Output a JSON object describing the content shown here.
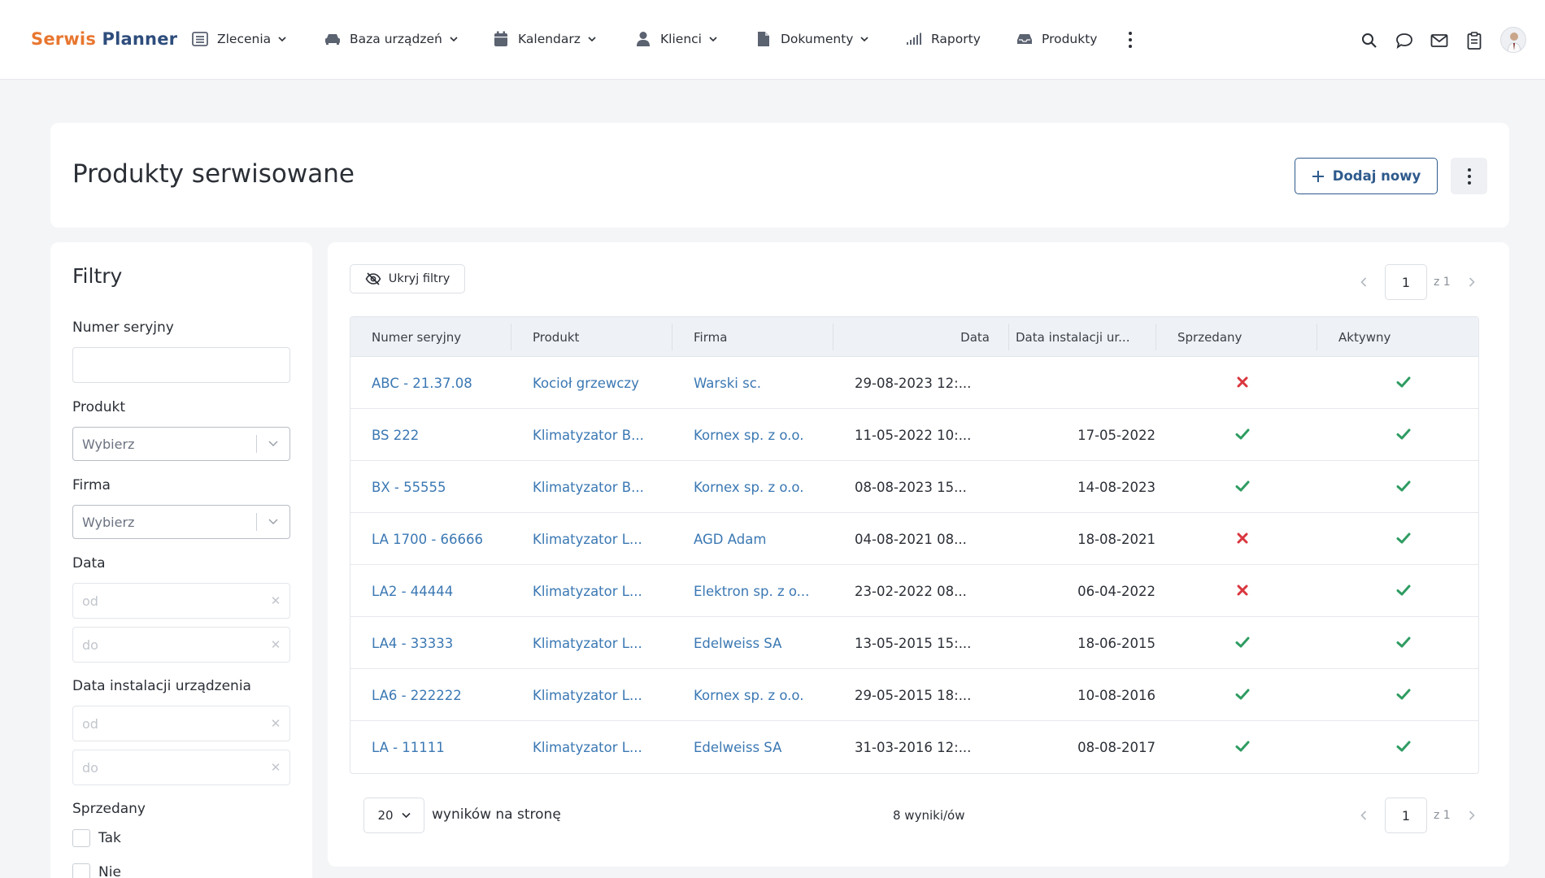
{
  "app": {
    "logo_part1": "Serwis",
    "logo_part2": "Planner"
  },
  "nav": [
    {
      "label": "Zlecenia",
      "icon": "list-icon",
      "dropdown": true
    },
    {
      "label": "Baza urządzeń",
      "icon": "car-icon",
      "dropdown": true
    },
    {
      "label": "Kalendarz",
      "icon": "calendar-icon",
      "dropdown": true
    },
    {
      "label": "Klienci",
      "icon": "user-icon",
      "dropdown": true
    },
    {
      "label": "Dokumenty",
      "icon": "document-icon",
      "dropdown": true
    },
    {
      "label": "Raporty",
      "icon": "bar-signal-icon",
      "dropdown": false
    },
    {
      "label": "Produkty",
      "icon": "inbox-icon",
      "dropdown": false
    }
  ],
  "header": {
    "title": "Produkty serwisowane",
    "add_label": "Dodaj nowy"
  },
  "filters": {
    "title": "Filtry",
    "serial_label": "Numer seryjny",
    "product_label": "Produkt",
    "product_placeholder": "Wybierz",
    "company_label": "Firma",
    "company_placeholder": "Wybierz",
    "date_label": "Data",
    "date_from": "od",
    "date_to": "do",
    "install_label": "Data instalacji urządzenia",
    "install_from": "od",
    "install_to": "do",
    "sold_label": "Sprzedany",
    "sold_yes": "Tak",
    "sold_no": "Nie"
  },
  "toolbar": {
    "hide_filters": "Ukryj filtry"
  },
  "pagination": {
    "page": "1",
    "of": "z 1",
    "page_size": "20",
    "page_size_label": "wyników na stronę",
    "count": "8 wyniki/ów"
  },
  "table": {
    "columns": [
      "Numer seryjny",
      "Produkt",
      "Firma",
      "Data",
      "Data instalacji ur...",
      "Sprzedany",
      "Aktywny"
    ],
    "rows": [
      {
        "serial": "ABC - 21.37.08",
        "product": "Kocioł grzewczy",
        "company": "Warski sc.",
        "date": "29-08-2023 12:...",
        "install": "",
        "sold": false,
        "active": true
      },
      {
        "serial": "BS 222",
        "product": "Klimatyzator B...",
        "company": "Kornex sp. z o.o.",
        "date": "11-05-2022 10:...",
        "install": "17-05-2022",
        "sold": true,
        "active": true
      },
      {
        "serial": "BX - 55555",
        "product": "Klimatyzator B...",
        "company": "Kornex sp. z o.o.",
        "date": "08-08-2023 15...",
        "install": "14-08-2023",
        "sold": true,
        "active": true
      },
      {
        "serial": "LA 1700 - 66666",
        "product": "Klimatyzator L...",
        "company": "AGD Adam",
        "date": "04-08-2021 08...",
        "install": "18-08-2021",
        "sold": false,
        "active": true
      },
      {
        "serial": "LA2 - 44444",
        "product": "Klimatyzator L...",
        "company": "Elektron sp. z o...",
        "date": "23-02-2022 08...",
        "install": "06-04-2022",
        "sold": false,
        "active": true
      },
      {
        "serial": "LA4 - 33333",
        "product": "Klimatyzator L...",
        "company": "Edelweiss SA",
        "date": "13-05-2015 15:...",
        "install": "18-06-2015",
        "sold": true,
        "active": true
      },
      {
        "serial": "LA6 - 222222",
        "product": "Klimatyzator L...",
        "company": "Kornex sp. z o.o.",
        "date": "29-05-2015 18:...",
        "install": "10-08-2016",
        "sold": true,
        "active": true
      },
      {
        "serial": "LA - 11111",
        "product": "Klimatyzator L...",
        "company": "Edelweiss SA",
        "date": "31-03-2016 12:...",
        "install": "08-08-2017",
        "sold": true,
        "active": true
      }
    ]
  },
  "colors": {
    "accent": "#2e5a8c",
    "link": "#3b78b3",
    "check": "#2f9c62",
    "cross": "#d9363e",
    "logo_orange": "#e8762f",
    "logo_blue": "#2e4d7c"
  }
}
